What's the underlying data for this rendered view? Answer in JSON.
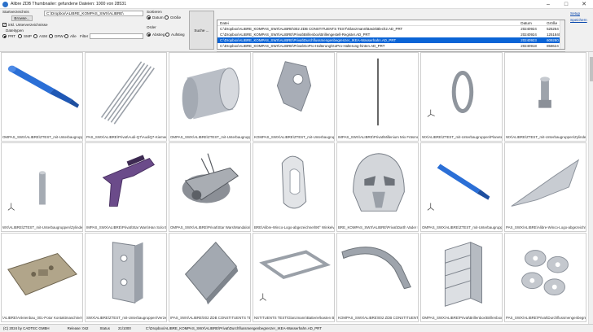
{
  "window": {
    "title": "Alibre ZDB Thumbnailer: gefundene Dateien: 1000 von 28531"
  },
  "controls": {
    "start_dir_label": "Startverzeichnis",
    "start_dir_value": "C:\\Dropbox\\ALIBRE_KOMPAS_SWX\\ALIBRE\\",
    "browse_label": "Browse...",
    "subdirs_label": "inkl. Unterverzeichnisse",
    "filetypes_label": "Dateitypen",
    "types": [
      "PRT",
      "SMP",
      "ASM",
      "DRW",
      "Alle"
    ],
    "filter_label": "Filter",
    "filter_value": "",
    "sort_label": "Sortieren",
    "sort_date": "Datum",
    "sort_size": "Größe",
    "order_label": "Order",
    "order_asc": "Abstieg",
    "order_desc": "Aufstieg",
    "search_label": "Suche ..."
  },
  "file_list": {
    "col_name": "Datei",
    "col_date": "Datum",
    "col_size": "Größe",
    "rows": [
      {
        "name": "C:\\Dropbox\\ALIBRE_KOMPAS_SWX\\ALIBRE\\002 ZDB CONSTITUENTS TEST\\Glanzmann\\Basis\\Blech2.AD_PRT",
        "date": "20240924",
        "size": "525264"
      },
      {
        "name": "C:\\Dropbox\\ALIBRE_KOMPAS_SWX\\ALIBRE\\Privat\\Brillenbox\\Brillengestell-Register.AD_PRT",
        "date": "20240924",
        "size": "1251840"
      },
      {
        "name": "C:\\Dropbox\\ALIBRE_KOMPAS_SWX\\ALIBRE\\Privat\\Durchflussmengenbegrenzer_IKEA-Wasserhahn.AD_PRT",
        "date": "20240923",
        "size": "609280"
      },
      {
        "name": "C:\\Dropbox\\ALIBRE_KOMPAS_SWX\\ALIBRE\\Privat\\GoPro-Halterung\\GoPro-Halterung-hinten.AD_PRT",
        "date": "20240918",
        "size": "858624"
      }
    ],
    "more_label": "MEHR ANZEIGEN..."
  },
  "links": {
    "setup": "Setup",
    "save": "Speichern"
  },
  "grid": {
    "captions": [
      "OMPAS_SWX\\ALIBRE\\ZTEST_mit-Unterbaugruppen\\",
      "PAS_SWX\\ALIBRE\\Privat\\Audi-Q7\\AudiQ7-Kiemen",
      "OMPAS_SWX\\ALIBRE\\ZTEST_mit-Unterbaugruppen",
      "KOMPAS_SWX\\ALIBRE\\ZTEST_mit-Unterbaugrupp",
      "IMPAS_SWX\\ALIBRE\\Privat\\Millenium Mio Fräsmaschine\\",
      "WX\\ALIBRE\\ZTEST_mit-Unterbaugruppen\\Planeten",
      "WX\\ALIBRE\\ZTEST_mit-Unterbaugruppen\\Zylinderst",
      "WX\\ALIBRE\\ZTEST_mit-Unterbaugruppen\\Zylinderst",
      "IMPAS_SWX\\ALIBRE\\Privat\\Star Wars\\Han Solo B",
      "OMPAS_SWX\\ALIBRE\\Privat\\Star Wars\\Mandalorian",
      "BRE\\Alibre-Winco-Logo-abgezeichnet\\90° Winkelve",
      "BRE_KOMPAS_SWX\\ALIBRE\\Privat\\Darth Vader H",
      "OMPAS_SWX\\ALIBRE\\ZTEST_mit-Unterbaugruppen",
      "PAS_SWX\\ALIBRE\\Alibre-Winco-Logo-abgezeichnet",
      "\\ALIBRE\\Anleienbau_001-Potor Kontaktmaschine\\",
      "SWX\\ALIBRE\\ZTEST_mit-Unterbaugruppen\\Verze",
      "IPAS_SWX\\ALIBRE\\002 ZDB CONSTITUENTS TEST\\",
      "NSTITUENTS TEST\\Glanzmann\\Batterie\\kasten BK",
      "KOMPAS_SWX\\ALIBRE\\002 ZDB CONSTITUENTS TEST\\Gl",
      "OMPAS_SWX\\ALIBRE\\Privat\\Brillenbox\\Brillenbox",
      "PAS_SWX\\ALIBRE\\Privat\\Durchflussmengenbegrenzer"
    ]
  },
  "status": {
    "copyright": "(C) 2024 by CADTEC GMBH",
    "release": "Release: 042",
    "status_label": "Status",
    "status_value": "21/1000",
    "path": "C:\\Dropbox\\ALIBRE_KOMPAS_SWX\\ALIBRE\\Privat\\Durchflussmengenbegrenzer_IKEA-Wasserhahn.AD_PRT"
  }
}
